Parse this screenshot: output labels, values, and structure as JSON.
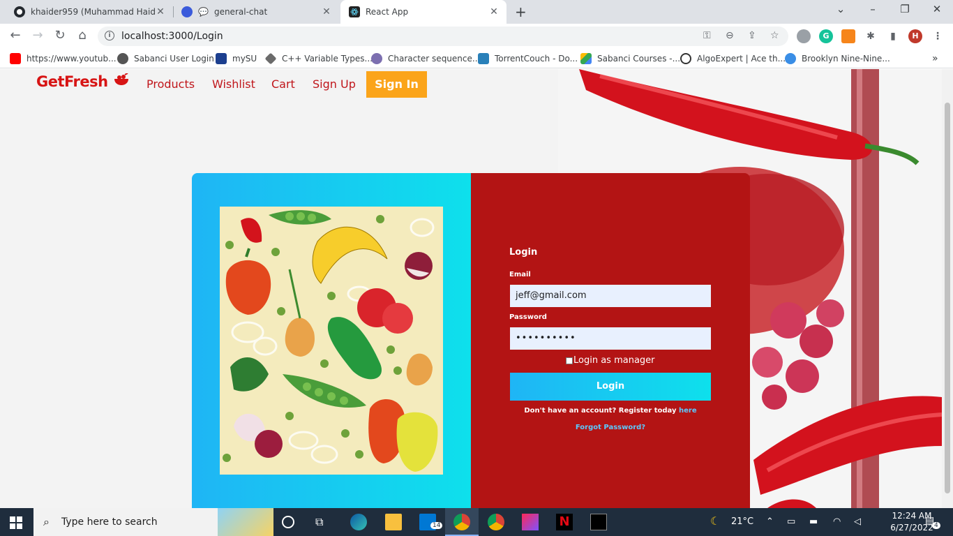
{
  "browser": {
    "tabs": [
      {
        "title": "khaider959 (Muhammad Haider",
        "icon": "github-icon"
      },
      {
        "title": "general-chat",
        "icon": "chat-icon"
      },
      {
        "title": "React App",
        "icon": "react-icon"
      }
    ],
    "url": "localhost:3000/Login",
    "profile_initial": "H",
    "bookmarks": [
      "https://www.youtub...",
      "Sabanci User Login",
      "mySU",
      "C++ Variable Types...",
      "Character sequence...",
      "TorrentCouch - Do...",
      "Sabanci Courses -...",
      "AlgoExpert | Ace th...",
      "Brooklyn Nine-Nine..."
    ]
  },
  "site": {
    "brand": "GetFresh",
    "nav": {
      "products": "Products",
      "wishlist": "Wishlist",
      "cart": "Cart",
      "signup": "Sign Up",
      "signin": "Sign In"
    }
  },
  "login": {
    "title": "Login",
    "email_label": "Email",
    "email_value": "jeff@gmail.com",
    "password_label": "Password",
    "password_value": "••••••••••",
    "manager_label": "Login as manager",
    "submit_label": "Login",
    "register_text": "Don't have an account? Register today",
    "register_link": "here",
    "forgot_label": "Forgot Password?"
  },
  "taskbar": {
    "search_placeholder": "Type here to search",
    "temperature": "21°C",
    "time": "12:24 AM",
    "date": "6/27/2022",
    "mail_badge": "14",
    "notif_badge": "4"
  },
  "colors": {
    "brand_red": "#d71414",
    "signin_orange": "#fba41a",
    "panel_red": "#b31414",
    "gradient_blue": "#1fb5f5",
    "gradient_cyan": "#0ee0ec"
  }
}
